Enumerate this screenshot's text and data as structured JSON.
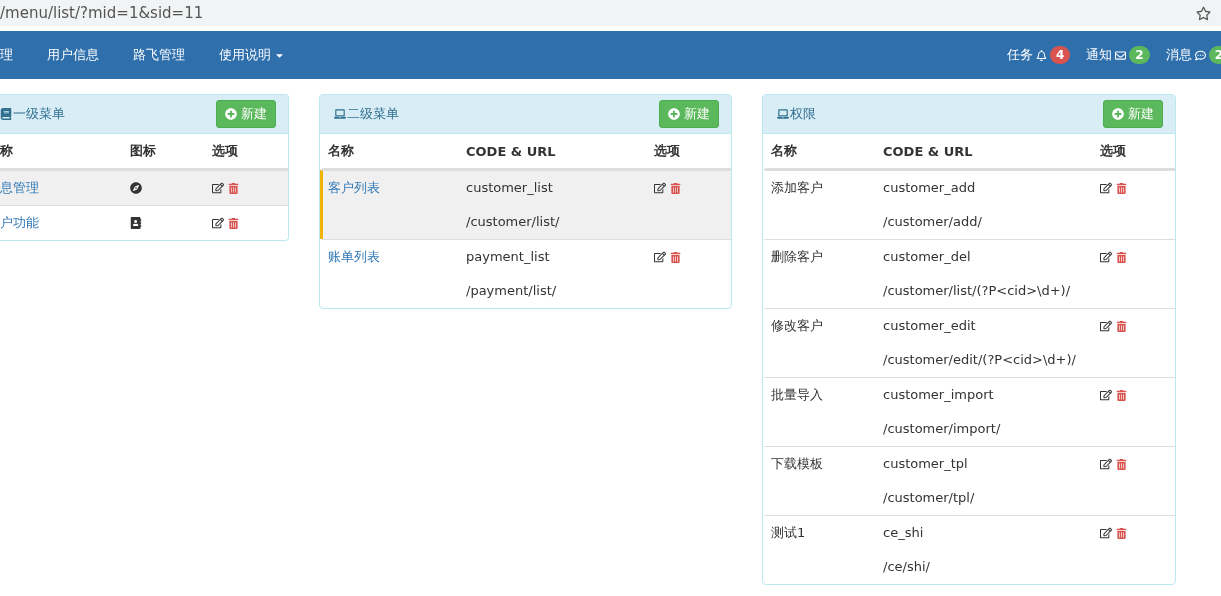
{
  "url_bar": {
    "url": "/menu/list/?mid=1&sid=11"
  },
  "nav": {
    "items": [
      {
        "label": "理",
        "dropdown": false
      },
      {
        "label": "用户信息",
        "dropdown": false
      },
      {
        "label": "路飞管理",
        "dropdown": false
      },
      {
        "label": "使用说明",
        "dropdown": true
      }
    ],
    "alerts": [
      {
        "label": "任务",
        "badge": "4",
        "color": "#d9534f"
      },
      {
        "label": "通知",
        "badge": "2",
        "color": "#5cb85c"
      },
      {
        "label": "消息",
        "badge": "2",
        "color": "#5cb85c"
      }
    ]
  },
  "panels": [
    {
      "kind": "level1",
      "title": "一级菜单",
      "new_button": "新建",
      "columns": [
        "称",
        "图标",
        "选项"
      ],
      "rows": [
        {
          "name": "息管理",
          "selected": true
        },
        {
          "name": "户功能",
          "selected": false
        }
      ]
    },
    {
      "kind": "level2",
      "title": "二级菜单",
      "new_button": "新建",
      "columns": [
        "名称",
        "CODE & URL",
        "选项"
      ],
      "rows": [
        {
          "name": "客户列表",
          "code": "customer_list",
          "url": "/customer/list/",
          "selected": true
        },
        {
          "name": "账单列表",
          "code": "payment_list",
          "url": "/payment/list/",
          "selected": false
        }
      ]
    },
    {
      "kind": "permission",
      "title": "权限",
      "new_button": "新建",
      "columns": [
        "名称",
        "CODE & URL",
        "选项"
      ],
      "rows": [
        {
          "name": "添加客户",
          "code": "customer_add",
          "url": "/customer/add/",
          "selected": false
        },
        {
          "name": "删除客户",
          "code": "customer_del",
          "url": "/customer/list/(?P<cid>\\d+)/",
          "selected": false
        },
        {
          "name": "修改客户",
          "code": "customer_edit",
          "url": "/customer/edit/(?P<cid>\\d+)/",
          "selected": false
        },
        {
          "name": "批量导入",
          "code": "customer_import",
          "url": "/customer/import/",
          "selected": false
        },
        {
          "name": "下载模板",
          "code": "customer_tpl",
          "url": "/customer/tpl/",
          "selected": false
        },
        {
          "name": "测试1",
          "code": "ce_shi",
          "url": "/ce/shi/",
          "selected": false
        }
      ]
    }
  ]
}
